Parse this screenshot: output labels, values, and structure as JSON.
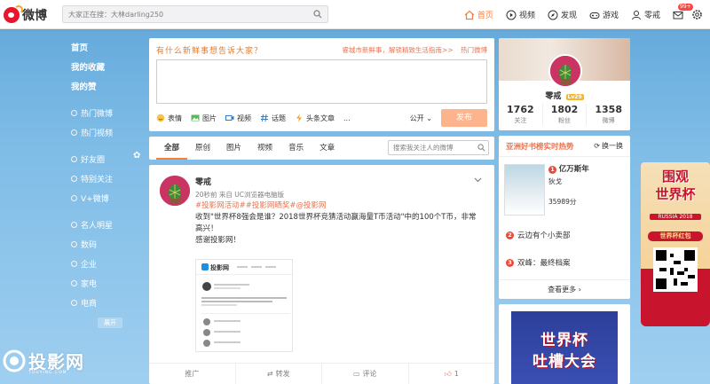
{
  "app": {
    "logo_text": "微博"
  },
  "search": {
    "placeholder": "大家正在搜：大林darling250"
  },
  "nav": {
    "items": [
      {
        "label": "首页",
        "icon": "home-icon",
        "active": true
      },
      {
        "label": "视频",
        "icon": "video-icon"
      },
      {
        "label": "发现",
        "icon": "compass-icon"
      },
      {
        "label": "游戏",
        "icon": "gamepad-icon"
      },
      {
        "label": "零戒",
        "icon": "user-icon"
      }
    ],
    "message_badge": "99+"
  },
  "sidebar": {
    "main": [
      "首页",
      "我的收藏",
      "我的赞"
    ],
    "hot": [
      "热门微博",
      "热门视频"
    ],
    "groups": [
      "好友圈",
      "特别关注",
      "V+微博"
    ],
    "categories": [
      "名人明星",
      "数码",
      "企业",
      "家电",
      "电商"
    ],
    "expand_label": "展开"
  },
  "post": {
    "prompt": "有什么新鲜事想告诉大家？",
    "hot_link": "睿城市新鲜事，解锁精致生活指南>>",
    "hot_label": "热门微博",
    "tools": [
      "表情",
      "图片",
      "视频",
      "话题",
      "头条文章",
      "..."
    ],
    "visibility": "公开",
    "publish_label": "发布"
  },
  "feed_tabs": {
    "tabs": [
      "全部",
      "原创",
      "图片",
      "视频",
      "音乐",
      "文章"
    ],
    "search_placeholder": "搜索我关注人的微博"
  },
  "card": {
    "author": "零戒",
    "meta": "20秒前 来自 UC浏览器电脑版",
    "tags": "#投影网活动##投影网晒奖#@投影网",
    "content": "收到\"世界杯8强会是谁？2018世界杯竞猜活动赢海量T币活动\"中的100个T币，非常高兴！",
    "thanks": "感谢投影网！",
    "thumb_logo": "投影网",
    "actions": [
      "推广",
      "转发",
      "评论",
      "1"
    ]
  },
  "profile": {
    "name": "零戒",
    "level": "Lv29",
    "stats": [
      {
        "num": "1762",
        "label": "关注"
      },
      {
        "num": "1802",
        "label": "粉丝"
      },
      {
        "num": "1358",
        "label": "微博"
      }
    ]
  },
  "ranking": {
    "title": "亚洲好书榜实时热势",
    "refresh": "换一换",
    "items": [
      {
        "rank": "1",
        "title": "亿万斯年",
        "sub": "狄戈",
        "score": "35989分"
      },
      {
        "rank": "2",
        "title": "云边有个小卖部"
      },
      {
        "rank": "3",
        "title": "双峰：最终档案"
      }
    ],
    "more": "查看更多 ›"
  },
  "ad": {
    "line1": "世界杯",
    "line2": "吐槽大会"
  },
  "promo": {
    "line1": "围观",
    "line2": "世界杯",
    "sub": "RUSSIA 2018",
    "redbag": "世界杯红包"
  },
  "watermark": {
    "text": "投影网",
    "sub": "TOUYING.COM"
  },
  "colors": {
    "accent": "#fa7d3c",
    "link": "#eb7350",
    "bg_top": "#5fa6d9"
  }
}
